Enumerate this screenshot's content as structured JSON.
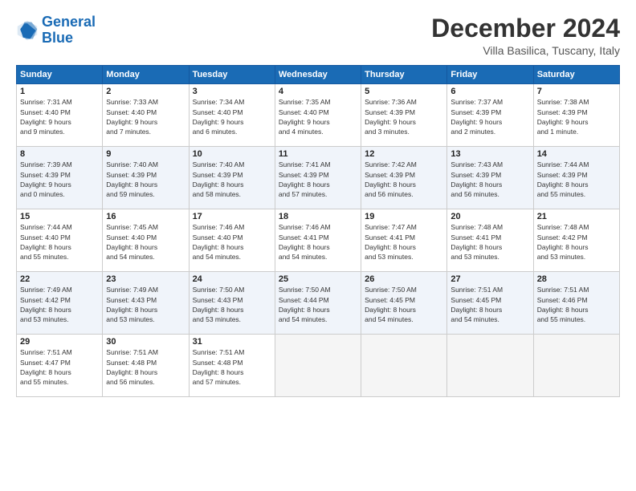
{
  "logo": {
    "line1": "General",
    "line2": "Blue"
  },
  "title": "December 2024",
  "subtitle": "Villa Basilica, Tuscany, Italy",
  "weekdays": [
    "Sunday",
    "Monday",
    "Tuesday",
    "Wednesday",
    "Thursday",
    "Friday",
    "Saturday"
  ],
  "weeks": [
    [
      {
        "day": "1",
        "info": "Sunrise: 7:31 AM\nSunset: 4:40 PM\nDaylight: 9 hours\nand 9 minutes."
      },
      {
        "day": "2",
        "info": "Sunrise: 7:33 AM\nSunset: 4:40 PM\nDaylight: 9 hours\nand 7 minutes."
      },
      {
        "day": "3",
        "info": "Sunrise: 7:34 AM\nSunset: 4:40 PM\nDaylight: 9 hours\nand 6 minutes."
      },
      {
        "day": "4",
        "info": "Sunrise: 7:35 AM\nSunset: 4:40 PM\nDaylight: 9 hours\nand 4 minutes."
      },
      {
        "day": "5",
        "info": "Sunrise: 7:36 AM\nSunset: 4:39 PM\nDaylight: 9 hours\nand 3 minutes."
      },
      {
        "day": "6",
        "info": "Sunrise: 7:37 AM\nSunset: 4:39 PM\nDaylight: 9 hours\nand 2 minutes."
      },
      {
        "day": "7",
        "info": "Sunrise: 7:38 AM\nSunset: 4:39 PM\nDaylight: 9 hours\nand 1 minute."
      }
    ],
    [
      {
        "day": "8",
        "info": "Sunrise: 7:39 AM\nSunset: 4:39 PM\nDaylight: 9 hours\nand 0 minutes."
      },
      {
        "day": "9",
        "info": "Sunrise: 7:40 AM\nSunset: 4:39 PM\nDaylight: 8 hours\nand 59 minutes."
      },
      {
        "day": "10",
        "info": "Sunrise: 7:40 AM\nSunset: 4:39 PM\nDaylight: 8 hours\nand 58 minutes."
      },
      {
        "day": "11",
        "info": "Sunrise: 7:41 AM\nSunset: 4:39 PM\nDaylight: 8 hours\nand 57 minutes."
      },
      {
        "day": "12",
        "info": "Sunrise: 7:42 AM\nSunset: 4:39 PM\nDaylight: 8 hours\nand 56 minutes."
      },
      {
        "day": "13",
        "info": "Sunrise: 7:43 AM\nSunset: 4:39 PM\nDaylight: 8 hours\nand 56 minutes."
      },
      {
        "day": "14",
        "info": "Sunrise: 7:44 AM\nSunset: 4:39 PM\nDaylight: 8 hours\nand 55 minutes."
      }
    ],
    [
      {
        "day": "15",
        "info": "Sunrise: 7:44 AM\nSunset: 4:40 PM\nDaylight: 8 hours\nand 55 minutes."
      },
      {
        "day": "16",
        "info": "Sunrise: 7:45 AM\nSunset: 4:40 PM\nDaylight: 8 hours\nand 54 minutes."
      },
      {
        "day": "17",
        "info": "Sunrise: 7:46 AM\nSunset: 4:40 PM\nDaylight: 8 hours\nand 54 minutes."
      },
      {
        "day": "18",
        "info": "Sunrise: 7:46 AM\nSunset: 4:41 PM\nDaylight: 8 hours\nand 54 minutes."
      },
      {
        "day": "19",
        "info": "Sunrise: 7:47 AM\nSunset: 4:41 PM\nDaylight: 8 hours\nand 53 minutes."
      },
      {
        "day": "20",
        "info": "Sunrise: 7:48 AM\nSunset: 4:41 PM\nDaylight: 8 hours\nand 53 minutes."
      },
      {
        "day": "21",
        "info": "Sunrise: 7:48 AM\nSunset: 4:42 PM\nDaylight: 8 hours\nand 53 minutes."
      }
    ],
    [
      {
        "day": "22",
        "info": "Sunrise: 7:49 AM\nSunset: 4:42 PM\nDaylight: 8 hours\nand 53 minutes."
      },
      {
        "day": "23",
        "info": "Sunrise: 7:49 AM\nSunset: 4:43 PM\nDaylight: 8 hours\nand 53 minutes."
      },
      {
        "day": "24",
        "info": "Sunrise: 7:50 AM\nSunset: 4:43 PM\nDaylight: 8 hours\nand 53 minutes."
      },
      {
        "day": "25",
        "info": "Sunrise: 7:50 AM\nSunset: 4:44 PM\nDaylight: 8 hours\nand 54 minutes."
      },
      {
        "day": "26",
        "info": "Sunrise: 7:50 AM\nSunset: 4:45 PM\nDaylight: 8 hours\nand 54 minutes."
      },
      {
        "day": "27",
        "info": "Sunrise: 7:51 AM\nSunset: 4:45 PM\nDaylight: 8 hours\nand 54 minutes."
      },
      {
        "day": "28",
        "info": "Sunrise: 7:51 AM\nSunset: 4:46 PM\nDaylight: 8 hours\nand 55 minutes."
      }
    ],
    [
      {
        "day": "29",
        "info": "Sunrise: 7:51 AM\nSunset: 4:47 PM\nDaylight: 8 hours\nand 55 minutes."
      },
      {
        "day": "30",
        "info": "Sunrise: 7:51 AM\nSunset: 4:48 PM\nDaylight: 8 hours\nand 56 minutes."
      },
      {
        "day": "31",
        "info": "Sunrise: 7:51 AM\nSunset: 4:48 PM\nDaylight: 8 hours\nand 57 minutes."
      },
      null,
      null,
      null,
      null
    ]
  ]
}
